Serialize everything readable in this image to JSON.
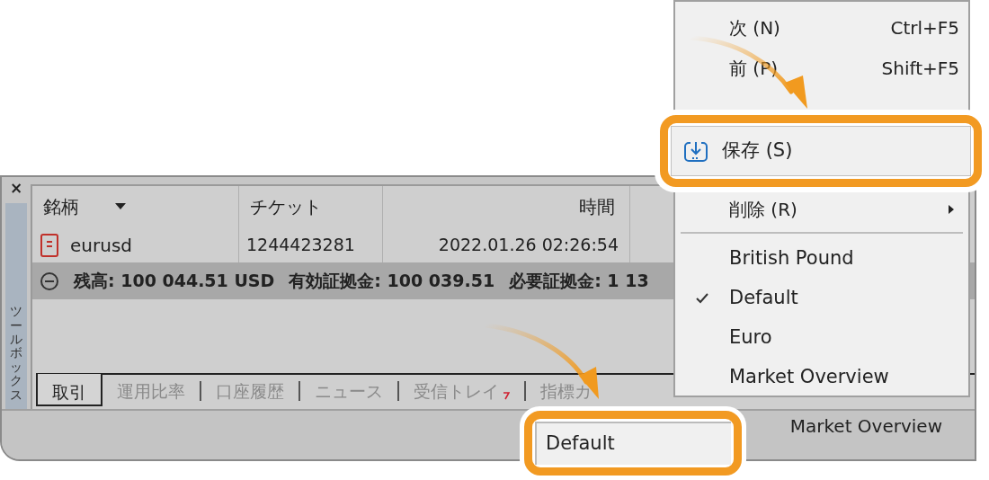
{
  "toolbox": {
    "close": "×",
    "title": "ツールボックス"
  },
  "table": {
    "columns": [
      {
        "label": "銘柄",
        "sortable": true
      },
      {
        "label": "チケット",
        "sortable": false
      },
      {
        "label": "時間",
        "sortable": false
      }
    ],
    "rows": [
      {
        "cells": [
          "eurusd",
          "1244423281",
          "2022.01.26 02:26:54"
        ]
      }
    ]
  },
  "summary": {
    "items": [
      "残高: 100 044.51 USD",
      "有効証拠金: 100 039.51",
      "必要証拠金: 1 13"
    ]
  },
  "tabs": [
    {
      "label": "取引",
      "selected": true,
      "badge": false
    },
    {
      "label": "運用比率",
      "selected": false,
      "badge": false
    },
    {
      "label": "口座履歴",
      "selected": false,
      "badge": false
    },
    {
      "label": "ニュース",
      "selected": false,
      "badge": false
    },
    {
      "label": "受信トレイ",
      "selected": false,
      "badge": true
    },
    {
      "label": "指標カ",
      "selected": false,
      "badge": false
    }
  ],
  "status_bar": {
    "label": "Market Overview"
  },
  "menu": {
    "items": [
      {
        "kind": "command",
        "label": "次 (N)",
        "shortcut": "Ctrl+F5"
      },
      {
        "kind": "command",
        "label": "前 (P)",
        "shortcut": "Shift+F5"
      },
      {
        "kind": "submenu",
        "label": "削除 (R)"
      },
      {
        "kind": "separator"
      },
      {
        "kind": "profile",
        "label": "British Pound",
        "checked": false
      },
      {
        "kind": "profile",
        "label": "Default",
        "checked": true
      },
      {
        "kind": "profile",
        "label": "Euro",
        "checked": false
      },
      {
        "kind": "profile",
        "label": "Market Overview",
        "checked": false
      }
    ]
  },
  "callouts": [
    {
      "kind": "menu_item",
      "label": "保存 (S)"
    },
    {
      "kind": "button",
      "label": "Default"
    }
  ]
}
